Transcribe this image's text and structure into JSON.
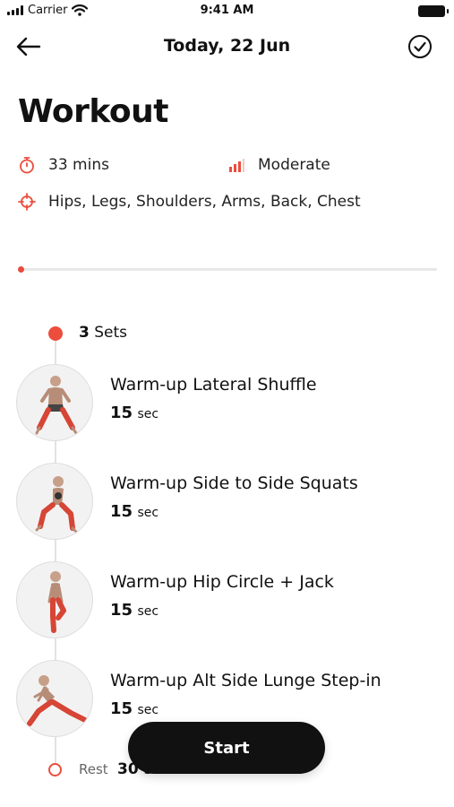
{
  "status_bar": {
    "carrier": "Carrier",
    "time": "9:41 AM"
  },
  "nav": {
    "title": "Today, 22 Jun"
  },
  "page_title": "Workout",
  "meta": {
    "duration": "33 mins",
    "intensity": "Moderate",
    "muscles": "Hips, Legs, Shoulders, Arms, Back, Chest"
  },
  "progress": {
    "fraction": 0.0
  },
  "sets": {
    "count": "3",
    "label": "Sets"
  },
  "exercises": [
    {
      "name": "Warm-up Lateral Shuffle",
      "duration": "15",
      "unit": "sec"
    },
    {
      "name": "Warm-up Side to Side Squats",
      "duration": "15",
      "unit": "sec"
    },
    {
      "name": "Warm-up Hip Circle + Jack",
      "duration": "15",
      "unit": "sec"
    },
    {
      "name": "Warm-up Alt Side Lunge Step-in",
      "duration": "15",
      "unit": "sec"
    }
  ],
  "rest": {
    "label": "Rest",
    "value": "30 s"
  },
  "start_button": {
    "label": "Start"
  },
  "colors": {
    "accent": "#ec4d3d",
    "text": "#111111",
    "button": "#111111"
  }
}
